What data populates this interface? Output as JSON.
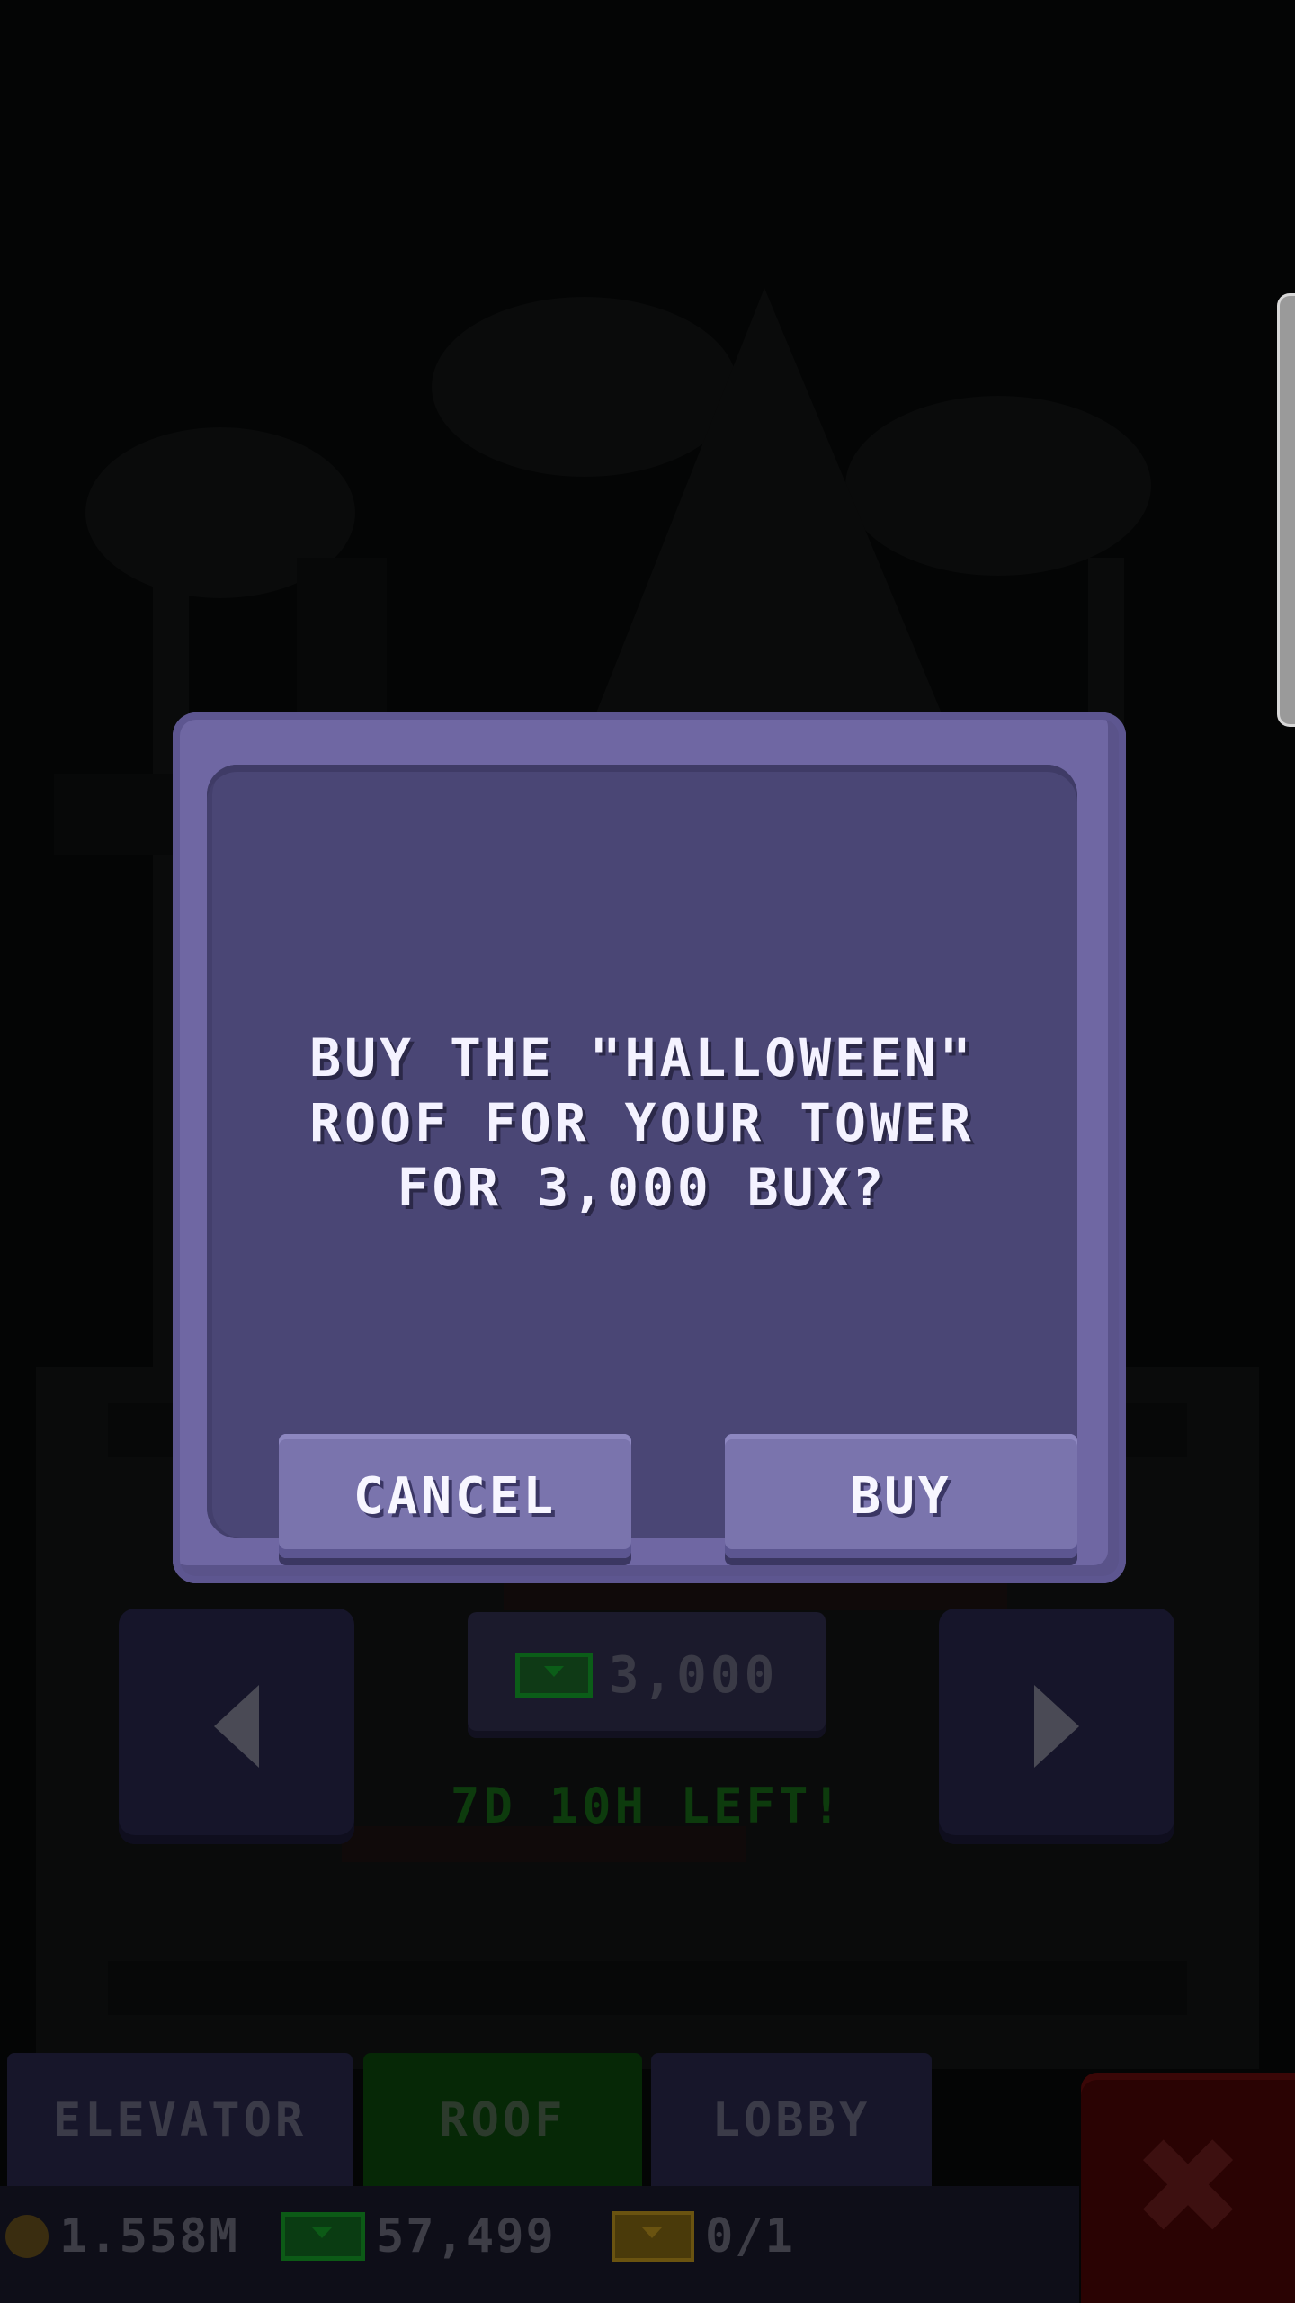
{
  "dialog": {
    "message": "BUY THE \"HALLOWEEN\" ROOF FOR YOUR TOWER FOR 3,000 BUX?",
    "cancel_label": "CANCEL",
    "buy_label": "BUY"
  },
  "shop": {
    "price": "3,000",
    "time_left": "7D 10H LEFT!"
  },
  "tabs": [
    {
      "label": "ELEVATOR"
    },
    {
      "label": "ROOF",
      "active": true
    },
    {
      "label": "LOBBY"
    }
  ],
  "status": {
    "coins": "1.558M",
    "bux": "57,499",
    "tickets": "0/1"
  },
  "icons": {
    "prev": "chevron-left-icon",
    "next": "chevron-right-icon",
    "close": "close-icon",
    "coin": "coin-icon",
    "bux": "bux-icon",
    "ticket": "ticket-icon"
  },
  "colors": {
    "dialog_outer": "#6f67a3",
    "dialog_inner": "#4a4675",
    "button": "#7a74ad",
    "active_tab": "#062806",
    "close_button": "#2a0303"
  }
}
